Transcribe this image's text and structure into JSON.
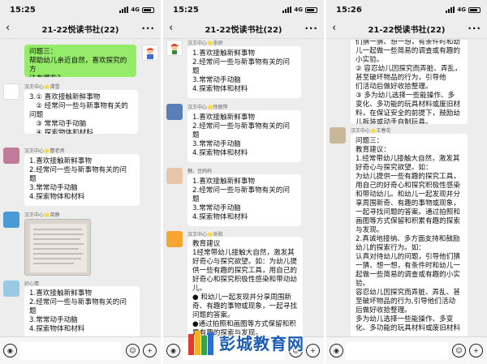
{
  "panels": [
    {
      "time": "15:25",
      "network": "4G",
      "title": "21-22悦读书社(22)",
      "messages": {
        "m1": "问题三：\n帮助幼儿亲近自然，喜欢探究的方\n法有哪些？",
        "m2_sender": "汉王中心🌟谭雪",
        "m2": "3.① 喜欢接触新鲜事物\n   ② 经常问一些与新事物有关的问题\n   ③ 常常动手动脑\n   ④ 探索物体和材料",
        "m3_sender": "汉王中心🌟曹老师",
        "m3": "1.喜欢接触新鲜事物\n2.经常问一些与新事物有关的问\n题\n3.常常动手动脑\n4.探索物体和材料",
        "m4_sender": "汉王中心🌟苗静",
        "m5_sender": "好心情",
        "m5": "1.喜欢接触新鲜事物\n2.经常问一些与新事物有关的问\n题\n3.常常动手动脑\n4.探索物体和材料"
      }
    },
    {
      "time": "15:25",
      "network": "4G",
      "title": "21-22悦读书社(22)",
      "messages": {
        "m1_sender": "汉王中心🌟张妍",
        "m1": "1.喜欢接触新鲜事物\n2.经常问一些与新事物有关的问\n题\n3.常常动手动脑\n4.探索物体和材料",
        "m2_sender": "汉王中心🌟徐丽萍",
        "m2": "1.喜欢接触新鲜事物\n2.经常问一些与新事物有关的问\n题\n3.常常动手动脑\n4.探索物体和材料",
        "m3_sender": "糖，豆妈妈",
        "m3": "1.喜欢接触新鲜事物\n2.经常问一些与新事物有关的问\n题\n3.常常动手动脑\n4.探索物体和材料",
        "m4_sender": "汉王中心🌟岳阳",
        "m4": "教育建议\n1经常带幼儿接触大自然，激发其\n好奇心与探究欲望。如：为幼儿提\n供一些有趣的探究工具，用自己的\n好奇心和探究积极性感染和带动幼\n儿。\n● 和幼儿一起发现并分享周围新\n奇、有趣的事物或现象，一起寻找\n问题的答案。\n●通过拍照和画图等方式保留和积\n累有趣的探索与发现。"
      }
    },
    {
      "time": "15:26",
      "network": "4G",
      "title": "21-22悦读书社(22)",
      "messages": {
        "m0": "们猜一猜、想一想，有条件时和幼\n儿一起做一些简易的调查或有趣的\n小实验。\n② 容忍幼儿因探究而弄脏、弄乱，\n甚至破坏物品的行为，引导他\n们活动后做好收拾整理。\n③ 多为幼儿选择一些能操作、多\n变化、多功能的玩具材料或废旧材\n料，在保证安全的前提下，鼓励幼\n儿拆装或动手自制玩具。",
        "m1_sender": "汉王中心🌟王春花",
        "m1": "问题三：\n教育建议：\n1.经常带幼儿接触大自然，激发其\n好奇心与探究欲望。如：\n为幼儿提供一些有趣的探究工具，\n用自己的好奇心和探究积极性感染\n和带动幼儿。和幼儿一起发现并分\n享周围新奇、有趣的事物或现象，\n一起寻找问题的答案。通过拍照和\n画图等方式保留和积累有趣的探索\n与发现。\n2.真诚地接纳、多方面支持和鼓励\n幼儿的探索行为。如：\n认真对待幼儿的问题，引导他们猜\n一猜、想一想，有条件时和幼儿一\n起做一些简易的调查或有趣的小实\n验。\n容忍幼儿因探究而弄脏、弄乱、甚\n至破坏物品的行为,引导他们活动\n后做好收拾整理。\n多为幼儿选择一些能操作、多变\n化、多功能的玩具材料或废旧材料"
      }
    }
  ],
  "input": {
    "voice_icon": "voice-icon",
    "emoji_icon": "emoji-icon",
    "plus_icon": "plus-icon"
  },
  "watermark": {
    "text": "彭城教育网"
  }
}
